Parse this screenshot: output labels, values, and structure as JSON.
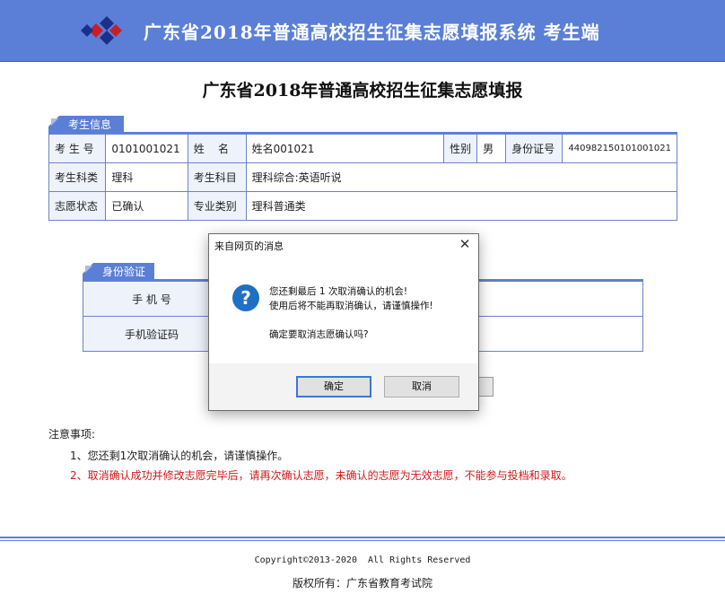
{
  "header": {
    "title": "广东省2018年普通高校招生征集志愿填报系统  考生端",
    "logo_icon": "diamond-logo-icon",
    "brand_color": "#5b7fd6"
  },
  "page_title": "广东省2018年普通高校招生征集志愿填报",
  "student_info": {
    "tab_label": "考生信息",
    "rows": [
      {
        "c1_label": "考 生 号",
        "c1_value": "0101001021",
        "c2_label": "姓    名",
        "c2_value": "姓名001021",
        "c3_label": "性别",
        "c3_value": "男",
        "c4_label": "身份证号",
        "c4_value": "440982150101001021"
      },
      {
        "c1_label": "考生科类",
        "c1_value": "理科",
        "c2_label": "考生科目",
        "c2_value": "理科综合:英语听说"
      },
      {
        "c1_label": "志愿状态",
        "c1_value": "已确认",
        "c2_label": "专业类别",
        "c2_value": "理科普通类"
      }
    ]
  },
  "verification": {
    "tab_label": "身份验证",
    "phone_label": "手 机 号",
    "code_label": "手机验证码"
  },
  "notice": {
    "title": "注意事项:",
    "items": [
      {
        "text": "1、您还剩1次取消确认的机会，请谨慎操作。",
        "color": "#222222"
      },
      {
        "text": "2、取消确认成功并修改志愿完毕后，请再次确认志愿，未确认的志愿为无效志愿，不能参与投档和录取。",
        "color": "#d0191b"
      }
    ]
  },
  "footer": {
    "copyright": "Copyright©2013-2020  All Rights Reserved",
    "owner": "版权所有：广东省教育考试院"
  },
  "dialog": {
    "title": "来自网页的消息",
    "icon": "question-icon",
    "line1": "您还剩最后 1 次取消确认的机会!",
    "line2": "使用后将不能再取消确认，请谨慎操作!",
    "line3": "确定要取消志愿确认吗?",
    "ok_label": "确定",
    "cancel_label": "取消"
  }
}
